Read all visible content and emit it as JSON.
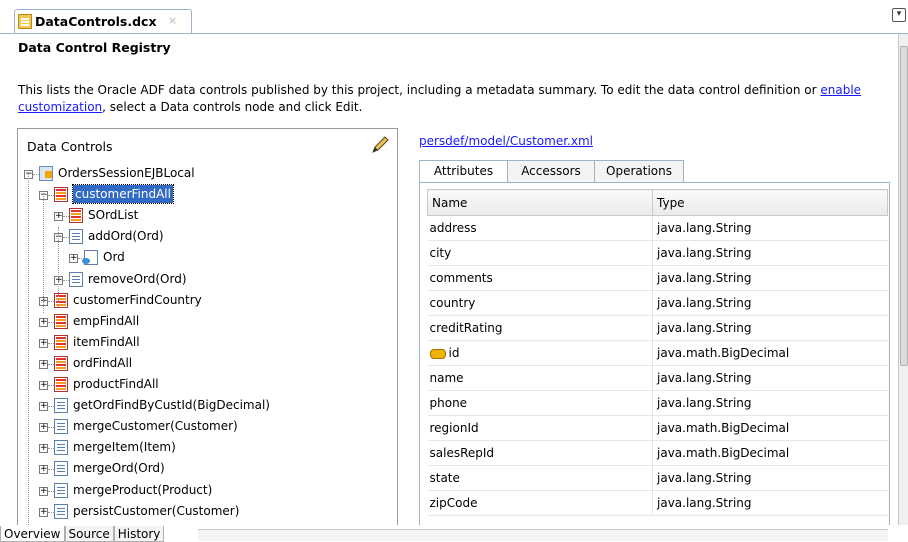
{
  "tab": {
    "title": "DataControls.dcx",
    "close": "×"
  },
  "editor": {
    "title": "Data Control Registry",
    "intro_before": "This lists the Oracle ADF data controls published by this project, including a metadata summary. To edit the data control definition or ",
    "intro_link": "enable customization",
    "intro_after": ", select a Data controls node and click Edit."
  },
  "left": {
    "header": "Data Controls",
    "tree": [
      {
        "label": "OrdersSessionEJBLocal",
        "icon": "ejb-bean-icon",
        "expander": "minus"
      },
      {
        "label": "customerFindAll",
        "icon": "collection-icon",
        "expander": "minus",
        "selected": true
      },
      {
        "label": "SOrdList",
        "icon": "collection-icon",
        "expander": "plus"
      },
      {
        "label": "addOrd(Ord)",
        "icon": "method-icon",
        "expander": "minus"
      },
      {
        "label": "Ord",
        "icon": "parameter-icon",
        "expander": "plus"
      },
      {
        "label": "removeOrd(Ord)",
        "icon": "method-icon",
        "expander": "plus"
      },
      {
        "label": "customerFindCountry",
        "icon": "collection-icon",
        "expander": "plus"
      },
      {
        "label": "empFindAll",
        "icon": "collection-icon",
        "expander": "plus"
      },
      {
        "label": "itemFindAll",
        "icon": "collection-icon",
        "expander": "plus"
      },
      {
        "label": "ordFindAll",
        "icon": "collection-icon",
        "expander": "plus"
      },
      {
        "label": "productFindAll",
        "icon": "collection-icon",
        "expander": "plus"
      },
      {
        "label": "getOrdFindByCustId(BigDecimal)",
        "icon": "method-icon",
        "expander": "plus"
      },
      {
        "label": "mergeCustomer(Customer)",
        "icon": "method-icon",
        "expander": "plus"
      },
      {
        "label": "mergeItem(Item)",
        "icon": "method-icon",
        "expander": "plus"
      },
      {
        "label": "mergeOrd(Ord)",
        "icon": "method-icon",
        "expander": "plus"
      },
      {
        "label": "mergeProduct(Product)",
        "icon": "method-icon",
        "expander": "plus"
      },
      {
        "label": "persistCustomer(Customer)",
        "icon": "method-icon",
        "expander": "plus"
      }
    ]
  },
  "right": {
    "file_link": "persdef/model/Customer.xml",
    "tabs": [
      "Attributes",
      "Accessors",
      "Operations"
    ],
    "columns": [
      "Name",
      "Type"
    ],
    "rows": [
      {
        "name": "address",
        "type": "java.lang.String"
      },
      {
        "name": "city",
        "type": "java.lang.String"
      },
      {
        "name": "comments",
        "type": "java.lang.String"
      },
      {
        "name": "country",
        "type": "java.lang.String"
      },
      {
        "name": "creditRating",
        "type": "java.lang.String"
      },
      {
        "name": "id",
        "type": "java.math.BigDecimal",
        "key": true
      },
      {
        "name": "name",
        "type": "java.lang.String"
      },
      {
        "name": "phone",
        "type": "java.lang.String"
      },
      {
        "name": "regionId",
        "type": "java.math.BigDecimal"
      },
      {
        "name": "salesRepId",
        "type": "java.math.BigDecimal"
      },
      {
        "name": "state",
        "type": "java.lang.String"
      },
      {
        "name": "zipCode",
        "type": "java.lang.String"
      }
    ]
  },
  "bottom_tabs": [
    "Overview",
    "Source",
    "History"
  ],
  "colors": {
    "selection": "#316ac5",
    "link": "#1a1aff",
    "border": "#9fb3c8"
  }
}
